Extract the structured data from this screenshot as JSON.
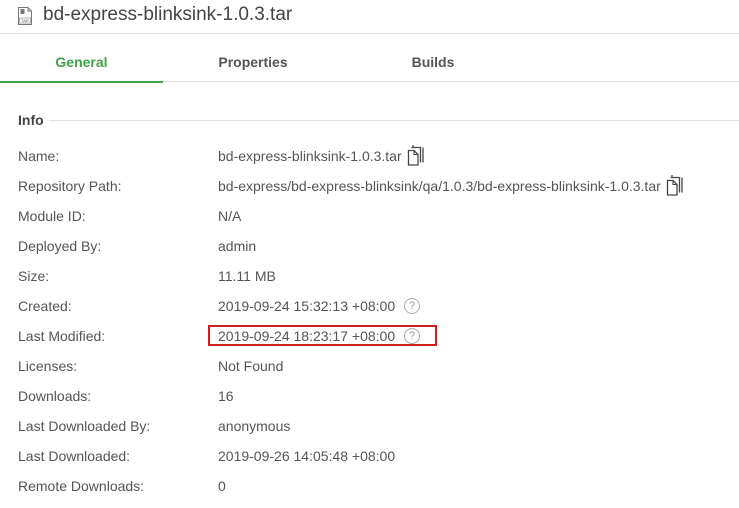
{
  "header": {
    "title": "bd-express-blinksink-1.0.3.tar"
  },
  "tabs": [
    {
      "label": "General"
    },
    {
      "label": "Properties"
    },
    {
      "label": "Builds"
    }
  ],
  "info": {
    "section_title": "Info",
    "rows": [
      {
        "label": "Name:",
        "value": "bd-express-blinksink-1.0.3.tar"
      },
      {
        "label": "Repository Path:",
        "value": "bd-express/bd-express-blinksink/qa/1.0.3/bd-express-blinksink-1.0.3.tar"
      },
      {
        "label": "Module ID:",
        "value": "N/A"
      },
      {
        "label": "Deployed By:",
        "value": "admin"
      },
      {
        "label": "Size:",
        "value": "11.11 MB"
      },
      {
        "label": "Created:",
        "value": "2019-09-24 15:32:13 +08:00"
      },
      {
        "label": "Last Modified:",
        "value": "2019-09-24 18:23:17 +08:00"
      },
      {
        "label": "Licenses:",
        "value": "Not Found"
      },
      {
        "label": "Downloads:",
        "value": "16"
      },
      {
        "label": "Last Downloaded By:",
        "value": "anonymous"
      },
      {
        "label": "Last Downloaded:",
        "value": "2019-09-26 14:05:48 +08:00"
      },
      {
        "label": "Remote Downloads:",
        "value": "0"
      }
    ]
  },
  "icons": {
    "file": "tar-file-icon",
    "copy": "copy-icon",
    "help": "help-icon"
  },
  "colors": {
    "active_tab": "#43a047",
    "highlight_border": "#cc1f1f"
  }
}
